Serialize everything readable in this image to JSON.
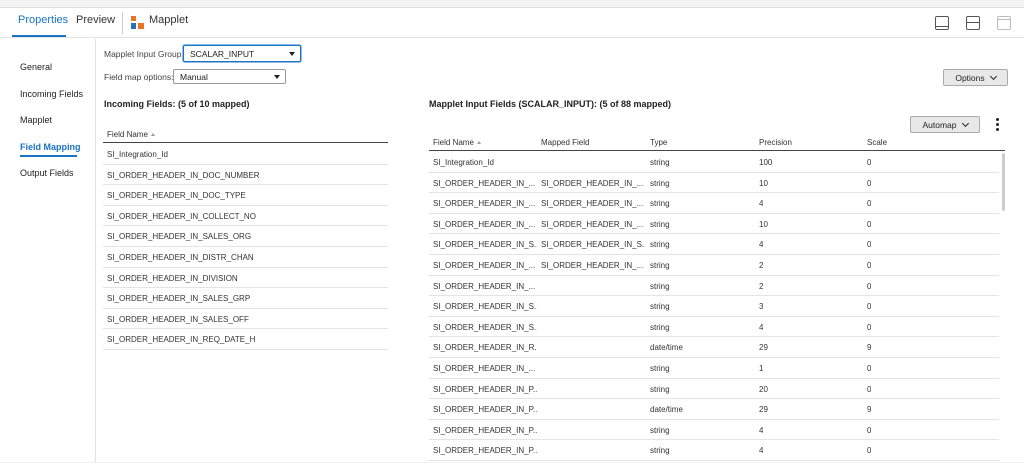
{
  "tabs": [
    {
      "label": "Properties",
      "active": true
    },
    {
      "label": "Preview",
      "active": false
    }
  ],
  "mapplet_title": "Mapplet",
  "nav": [
    {
      "label": "General",
      "active": false
    },
    {
      "label": "Incoming Fields",
      "active": false
    },
    {
      "label": "Mapplet",
      "active": false
    },
    {
      "label": "Field Mapping",
      "active": true
    },
    {
      "label": "Output Fields",
      "active": false
    }
  ],
  "form": {
    "input_group_label": "Mapplet Input Group:",
    "input_group_value": "SCALAR_INPUT",
    "field_map_label": "Field map options:",
    "field_map_value": "Manual",
    "options_button": "Options"
  },
  "incoming": {
    "title": "Incoming Fields: (5 of 10 mapped)",
    "header": "Field Name",
    "rows": [
      "SI_Integration_Id",
      "SI_ORDER_HEADER_IN_DOC_NUMBER",
      "SI_ORDER_HEADER_IN_DOC_TYPE",
      "SI_ORDER_HEADER_IN_COLLECT_NO",
      "SI_ORDER_HEADER_IN_SALES_ORG",
      "SI_ORDER_HEADER_IN_DISTR_CHAN",
      "SI_ORDER_HEADER_IN_DIVISION",
      "SI_ORDER_HEADER_IN_SALES_GRP",
      "SI_ORDER_HEADER_IN_SALES_OFF",
      "SI_ORDER_HEADER_IN_REQ_DATE_H"
    ]
  },
  "mapplet_input": {
    "title": "Mapplet Input Fields (SCALAR_INPUT): (5 of 88 mapped)",
    "automap_button": "Automap",
    "headers": {
      "field_name": "Field Name",
      "mapped_field": "Mapped Field",
      "type": "Type",
      "precision": "Precision",
      "scale": "Scale"
    },
    "rows": [
      {
        "field": "SI_Integration_Id",
        "mapped": "",
        "type": "string",
        "precision": "100",
        "scale": "0"
      },
      {
        "field": "SI_ORDER_HEADER_IN_...",
        "mapped": "SI_ORDER_HEADER_IN_...",
        "type": "string",
        "precision": "10",
        "scale": "0"
      },
      {
        "field": "SI_ORDER_HEADER_IN_...",
        "mapped": "SI_ORDER_HEADER_IN_...",
        "type": "string",
        "precision": "4",
        "scale": "0"
      },
      {
        "field": "SI_ORDER_HEADER_IN_...",
        "mapped": "SI_ORDER_HEADER_IN_...",
        "type": "string",
        "precision": "10",
        "scale": "0"
      },
      {
        "field": "SI_ORDER_HEADER_IN_S...",
        "mapped": "SI_ORDER_HEADER_IN_S...",
        "type": "string",
        "precision": "4",
        "scale": "0"
      },
      {
        "field": "SI_ORDER_HEADER_IN_...",
        "mapped": "SI_ORDER_HEADER_IN_...",
        "type": "string",
        "precision": "2",
        "scale": "0"
      },
      {
        "field": "SI_ORDER_HEADER_IN_...",
        "mapped": "",
        "type": "string",
        "precision": "2",
        "scale": "0"
      },
      {
        "field": "SI_ORDER_HEADER_IN_S...",
        "mapped": "",
        "type": "string",
        "precision": "3",
        "scale": "0"
      },
      {
        "field": "SI_ORDER_HEADER_IN_S...",
        "mapped": "",
        "type": "string",
        "precision": "4",
        "scale": "0"
      },
      {
        "field": "SI_ORDER_HEADER_IN_R...",
        "mapped": "",
        "type": "date/time",
        "precision": "29",
        "scale": "9"
      },
      {
        "field": "SI_ORDER_HEADER_IN_...",
        "mapped": "",
        "type": "string",
        "precision": "1",
        "scale": "0"
      },
      {
        "field": "SI_ORDER_HEADER_IN_P...",
        "mapped": "",
        "type": "string",
        "precision": "20",
        "scale": "0"
      },
      {
        "field": "SI_ORDER_HEADER_IN_P...",
        "mapped": "",
        "type": "date/time",
        "precision": "29",
        "scale": "9"
      },
      {
        "field": "SI_ORDER_HEADER_IN_P...",
        "mapped": "",
        "type": "string",
        "precision": "4",
        "scale": "0"
      },
      {
        "field": "SI_ORDER_HEADER_IN_P...",
        "mapped": "",
        "type": "string",
        "precision": "4",
        "scale": "0"
      }
    ]
  },
  "colors": {
    "accent": "#1a73c6",
    "mapplet_icon_orange": "#e8742a",
    "mapplet_icon_blue": "#2f6db5"
  }
}
